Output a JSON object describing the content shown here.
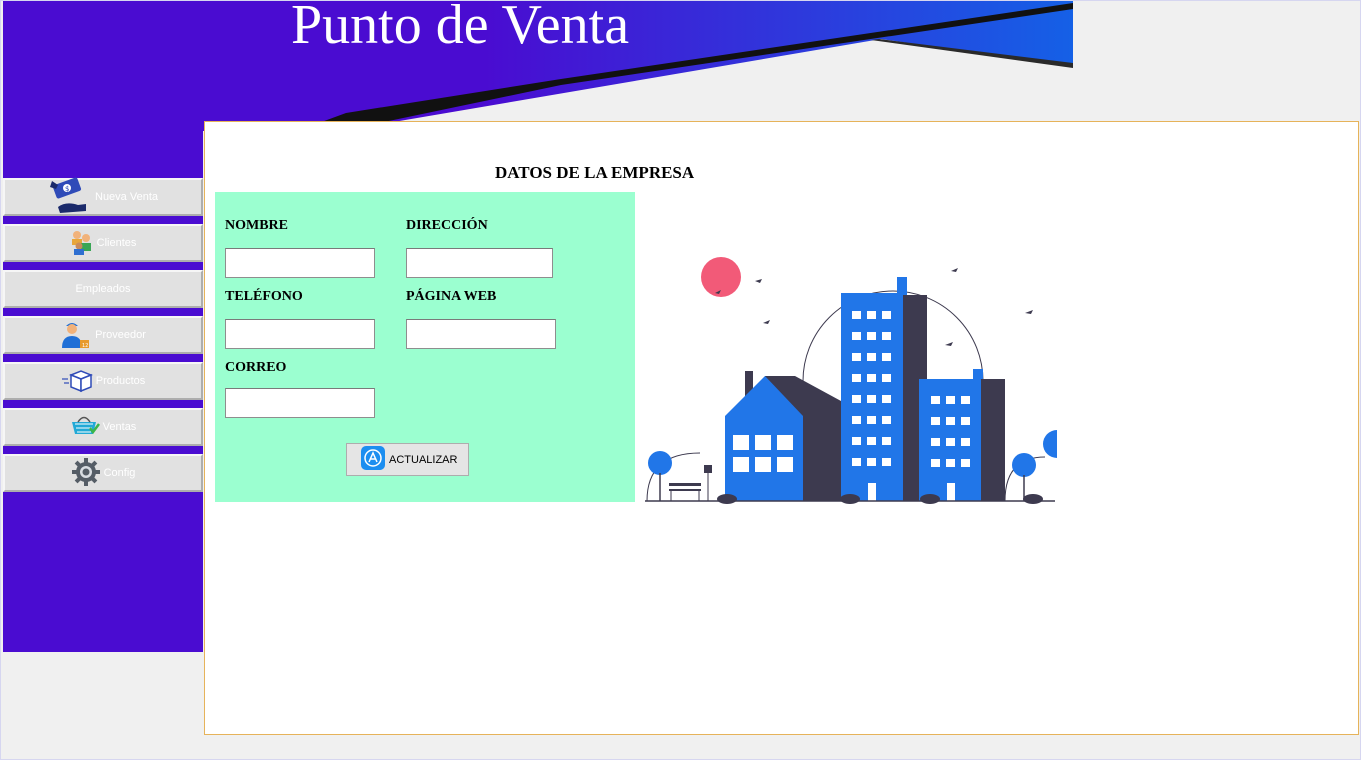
{
  "app": {
    "title": "Punto de Venta"
  },
  "sidebar": {
    "items": [
      {
        "label": "Nueva Venta",
        "icon": "cash-hand-icon"
      },
      {
        "label": "Clientes",
        "icon": "users-icon"
      },
      {
        "label": "Empleados",
        "icon": ""
      },
      {
        "label": "Proveedor",
        "icon": "delivery-person-icon"
      },
      {
        "label": "Productos",
        "icon": "box-icon"
      },
      {
        "label": "Ventas",
        "icon": "basket-icon"
      },
      {
        "label": "Config",
        "icon": "gear-icon"
      }
    ]
  },
  "company": {
    "section_title": "DATOS DE LA EMPRESA",
    "fields": {
      "nombre": {
        "label": "NOMBRE",
        "value": ""
      },
      "direccion": {
        "label": "DIRECCIÓN",
        "value": ""
      },
      "telefono": {
        "label": "TELÉFONO",
        "value": ""
      },
      "pagina_web": {
        "label": "PÁGINA WEB",
        "value": ""
      },
      "correo": {
        "label": "CORREO",
        "value": ""
      }
    },
    "update_label": "ACTUALIZAR"
  },
  "colors": {
    "sidebar": "#4a0cd1",
    "header_gradient_start": "#4a0cd1",
    "header_gradient_end": "#1560e6",
    "form_background": "#9bffd0",
    "panel_border": "#e6b35a",
    "building_blue": "#2176e8",
    "building_dark": "#3d3a4f",
    "sun": "#f25a78"
  }
}
